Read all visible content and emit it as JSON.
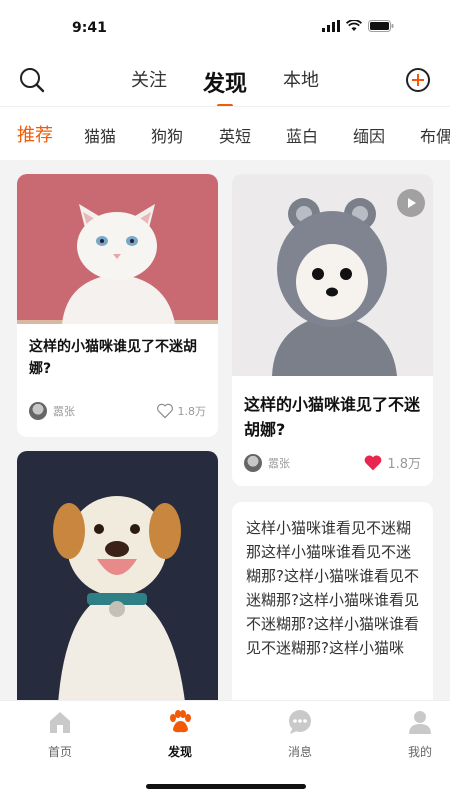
{
  "status_bar": {
    "time": "9:41"
  },
  "top_nav": {
    "tabs": [
      {
        "label": "关注",
        "active": false
      },
      {
        "label": "发现",
        "active": true
      },
      {
        "label": "本地",
        "active": false
      }
    ]
  },
  "categories": [
    {
      "label": "推荐",
      "active": true
    },
    {
      "label": "猫猫"
    },
    {
      "label": "狗狗"
    },
    {
      "label": "英短"
    },
    {
      "label": "蓝白"
    },
    {
      "label": "缅因"
    },
    {
      "label": "布偶"
    }
  ],
  "feed": {
    "card1": {
      "title": "这样的小猫咪谁见了不迷胡娜?",
      "author": "嚣张",
      "likes": "1.8万",
      "liked": false,
      "image": "white-cat"
    },
    "card2": {
      "title": "这样的小猫咪谁见了不迷胡娜?",
      "author": "嚣张",
      "likes": "1.8万",
      "liked": true,
      "image": "dog-in-hood",
      "has_video": true
    },
    "card3": {
      "image": "golden-dog"
    },
    "card4": {
      "text": "这样小猫咪谁看见不迷糊那这样小猫咪谁看见不迷糊那?这样小猫咪谁看见不迷糊那?这样小猫咪谁看见不迷糊那?这样小猫咪谁看见不迷糊那?这样小猫咪"
    }
  },
  "tab_bar": {
    "items": [
      {
        "label": "首页",
        "icon": "home-icon",
        "active": false
      },
      {
        "label": "发现",
        "icon": "paw-icon",
        "active": true
      },
      {
        "label": "消息",
        "icon": "message-icon",
        "active": false
      },
      {
        "label": "我的",
        "icon": "profile-icon",
        "active": false
      }
    ]
  },
  "colors": {
    "accent": "#f25a08",
    "like": "#e8264f",
    "background": "#f3f3f3"
  }
}
